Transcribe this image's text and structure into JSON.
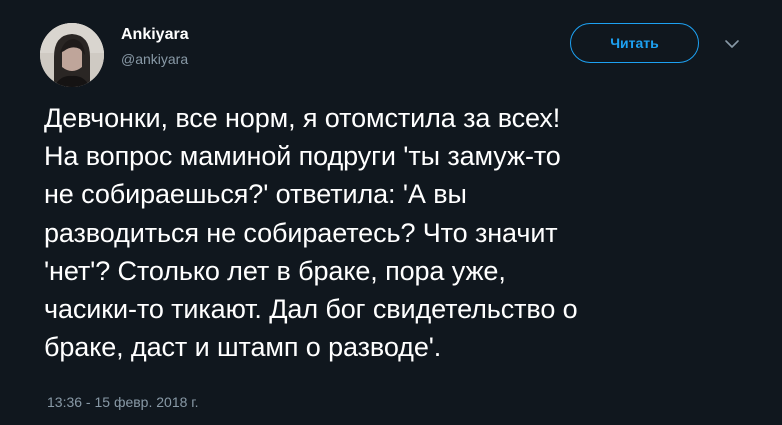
{
  "author": {
    "name": "Ankiyara",
    "handle": "@ankiyara"
  },
  "follow_button_label": "Читать",
  "tweet_lines": [
    "Девчонки, все норм, я отомстила за всех!",
    "На вопрос маминой подруги 'ты замуж-то",
    "не собираешься?' ответила: 'А вы",
    "разводиться не собираетесь? Что значит",
    "'нет'? Столько лет в браке, пора уже,",
    "часики-то тикают. Дал бог свидетельство о",
    "браке, даст и штамп о разводе'."
  ],
  "timestamp": "13:36 - 15 февр. 2018 г.",
  "icons": {
    "more_menu": "chevron-down-icon",
    "avatar": "avatar-photo"
  },
  "colors": {
    "background": "#10171e",
    "accent": "#1da1f2",
    "secondary_text": "#8899a6",
    "primary_text": "#ffffff"
  }
}
